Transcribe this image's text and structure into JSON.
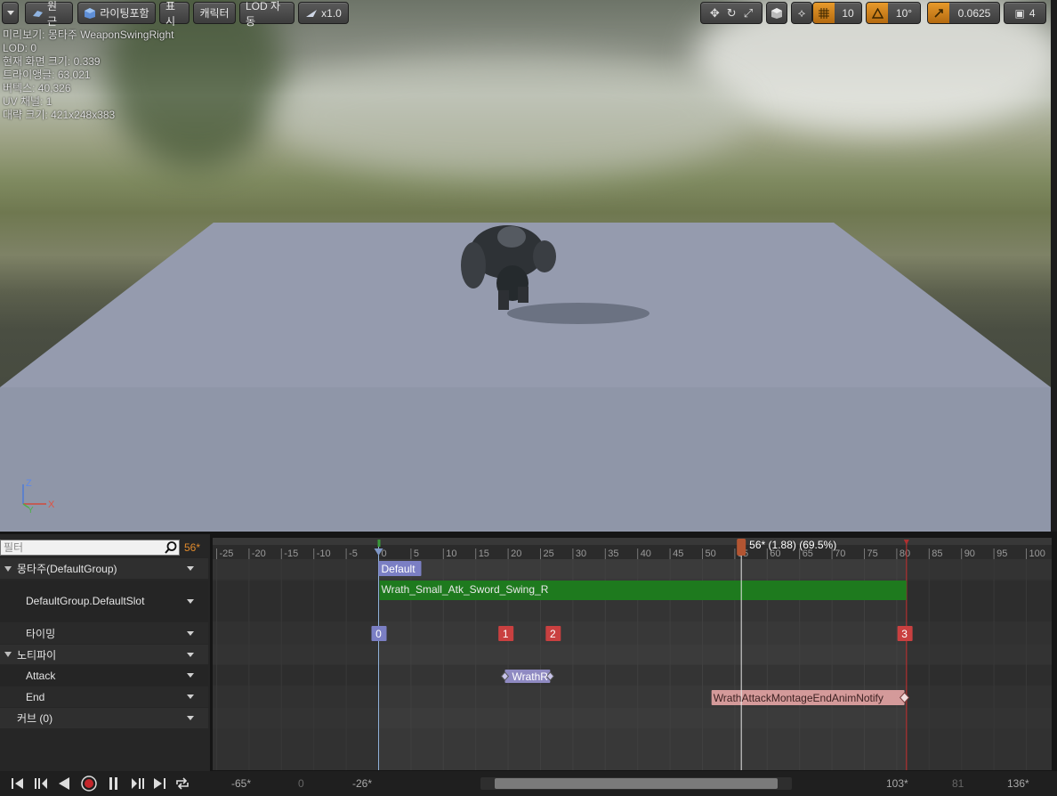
{
  "toolbar": {
    "dropdown_label": "",
    "perspective_label": "원근",
    "lighting_label": "라이팅포함",
    "show_label": "표시",
    "character_label": "캐릭터",
    "lod_label": "LOD 자동",
    "speed_label": "x1.0",
    "grid_snap_value": "10",
    "rotation_snap_value": "10°",
    "scale_snap_value": "0.0625",
    "camera_speed_value": "4"
  },
  "stats": {
    "preview": "미리보기: 몽타주 WeaponSwingRight",
    "lod": "LOD: 0",
    "screen_size": "현재 화면 크기: 0.339",
    "triangles": "트라이앵글: 63,021",
    "vertices": "버텍스: 40,326",
    "uv_channels": "UV 채널: 1",
    "approx_size": "대략 크기: 421x248x383"
  },
  "axis": {
    "z": "Z",
    "x": "X",
    "y": "Y"
  },
  "panel": {
    "filter_placeholder": "필터",
    "current_frame": "56*",
    "rows": [
      {
        "label": "몽타주(DefaultGroup)",
        "indent": "group"
      },
      {
        "label": "DefaultGroup.DefaultSlot",
        "indent": "child"
      },
      {
        "label": "타이밍",
        "indent": "child"
      },
      {
        "label": "노티파이",
        "indent": "group"
      },
      {
        "label": "Attack",
        "indent": "child"
      },
      {
        "label": "End",
        "indent": "child"
      },
      {
        "label": "커브  (0)",
        "indent": "plain"
      }
    ]
  },
  "timeline": {
    "ruler_ticks": [
      "-25",
      "-20",
      "-15",
      "-10",
      "-5",
      "0",
      "5",
      "10",
      "15",
      "20",
      "25",
      "30",
      "35",
      "40",
      "45",
      "50",
      "55",
      "60",
      "65",
      "70",
      "75",
      "80",
      "85",
      "90",
      "95",
      "100"
    ],
    "playhead_label": "56* (1.88) (69.5%)",
    "section_label": "Default",
    "segment_label": "Wrath_Small_Atk_Sword_Swing_R",
    "timing_markers": [
      "0",
      "1",
      "2",
      "3"
    ],
    "notify_attack": "WrathR",
    "notify_end": "WrathAttackMontageEndAnimNotify"
  },
  "bottom": {
    "range_start": "-65*",
    "range_zero": "0",
    "view_start": "-26*",
    "view_end": "103*",
    "range_end_dim": "81",
    "range_end": "136*"
  },
  "colors": {
    "accent": "#e08a2c",
    "segment": "#1e7a1e",
    "section": "#7b7fc4",
    "timing": "#c94040",
    "notify_attack": "#8f8ac2",
    "notify_end": "#d49a9a"
  }
}
